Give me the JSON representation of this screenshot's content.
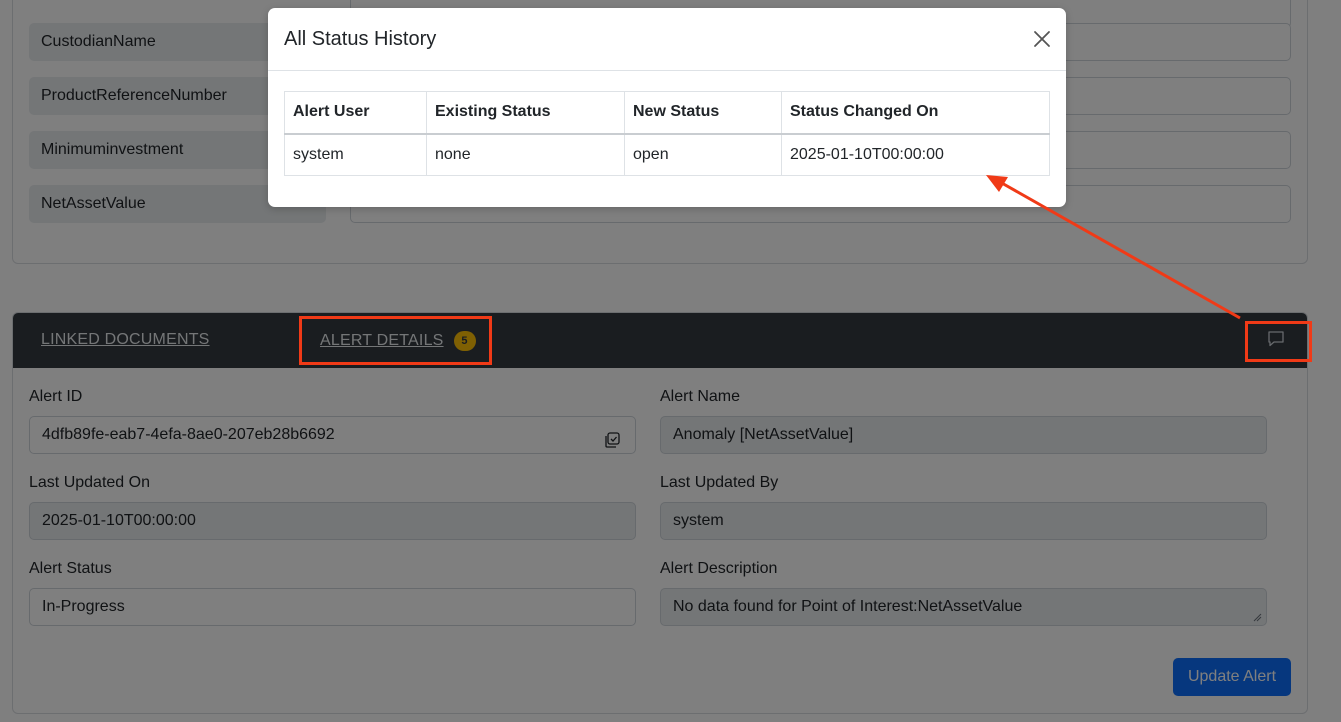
{
  "background_fields": [
    {
      "label": "CustodianName"
    },
    {
      "label": "ProductReferenceNumber"
    },
    {
      "label": "Minimuminvestment"
    },
    {
      "label": "NetAssetValue"
    }
  ],
  "tabs": {
    "linked_documents": "LINKED DOCUMENTS",
    "alert_details": "ALERT DETAILS",
    "alert_count": "5"
  },
  "alert_form": {
    "alert_id_label": "Alert ID",
    "alert_id_value": "4dfb89fe-eab7-4efa-8ae0-207eb28b6692",
    "alert_name_label": "Alert Name",
    "alert_name_value": "Anomaly [NetAssetValue]",
    "last_updated_on_label": "Last Updated On",
    "last_updated_on_value": "2025-01-10T00:00:00",
    "last_updated_by_label": "Last Updated By",
    "last_updated_by_value": "system",
    "alert_status_label": "Alert Status",
    "alert_status_value": "In-Progress",
    "alert_description_label": "Alert Description",
    "alert_description_value": "No data found for Point of Interest:NetAssetValue",
    "update_button": "Update Alert"
  },
  "modal": {
    "title": "All Status History",
    "columns": [
      "Alert User",
      "Existing Status",
      "New Status",
      "Status Changed On"
    ],
    "rows": [
      [
        "system",
        "none",
        "open",
        "2025-01-10T00:00:00"
      ]
    ]
  },
  "icons": {
    "close": "close-icon",
    "copy": "copy-icon",
    "comment": "comment-icon"
  },
  "colors": {
    "annotation": "#f03a17",
    "primary": "#0d6efd",
    "tab_bar": "#343a40",
    "badge": "#ffc107"
  }
}
